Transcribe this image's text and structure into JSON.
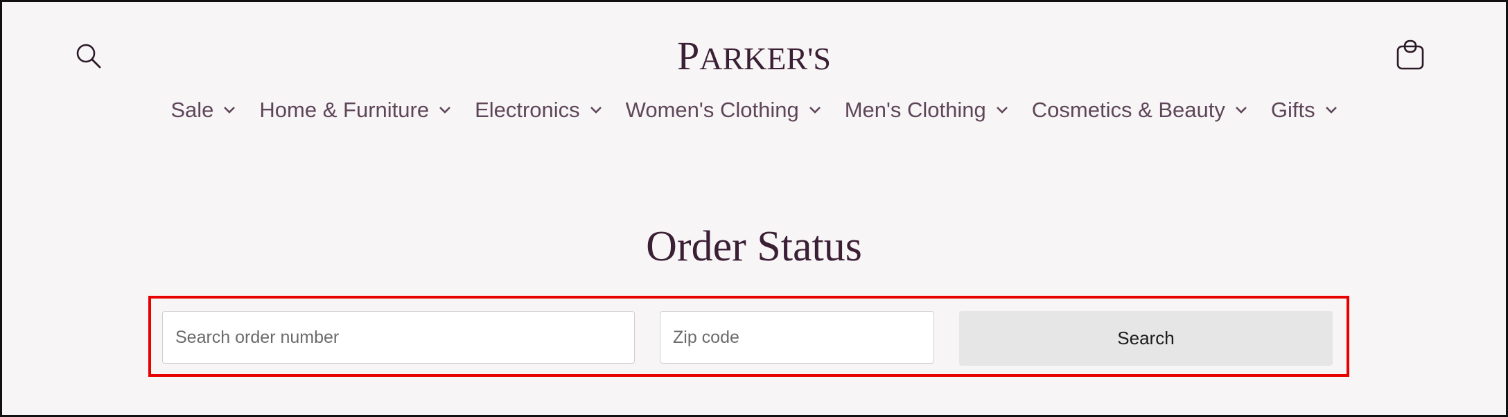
{
  "header": {
    "logo_text_first": "P",
    "logo_text_rest": "ARKER'S",
    "search_icon": "search-icon",
    "cart_icon": "shopping-bag-icon"
  },
  "nav": {
    "items": [
      {
        "label": "Sale"
      },
      {
        "label": "Home & Furniture"
      },
      {
        "label": "Electronics"
      },
      {
        "label": "Women's Clothing"
      },
      {
        "label": "Men's Clothing"
      },
      {
        "label": "Cosmetics & Beauty"
      },
      {
        "label": "Gifts"
      }
    ],
    "chevron_icon": "chevron-down-icon"
  },
  "main": {
    "title": "Order Status",
    "order_placeholder": "Search order number",
    "order_value": "",
    "zip_placeholder": "Zip code",
    "zip_value": "",
    "search_label": "Search"
  },
  "colors": {
    "background": "#f8f5f6",
    "brand": "#3b1f35",
    "nav_text": "#5e4659",
    "highlight": "#e60000",
    "button_bg": "#e6e6e6"
  }
}
